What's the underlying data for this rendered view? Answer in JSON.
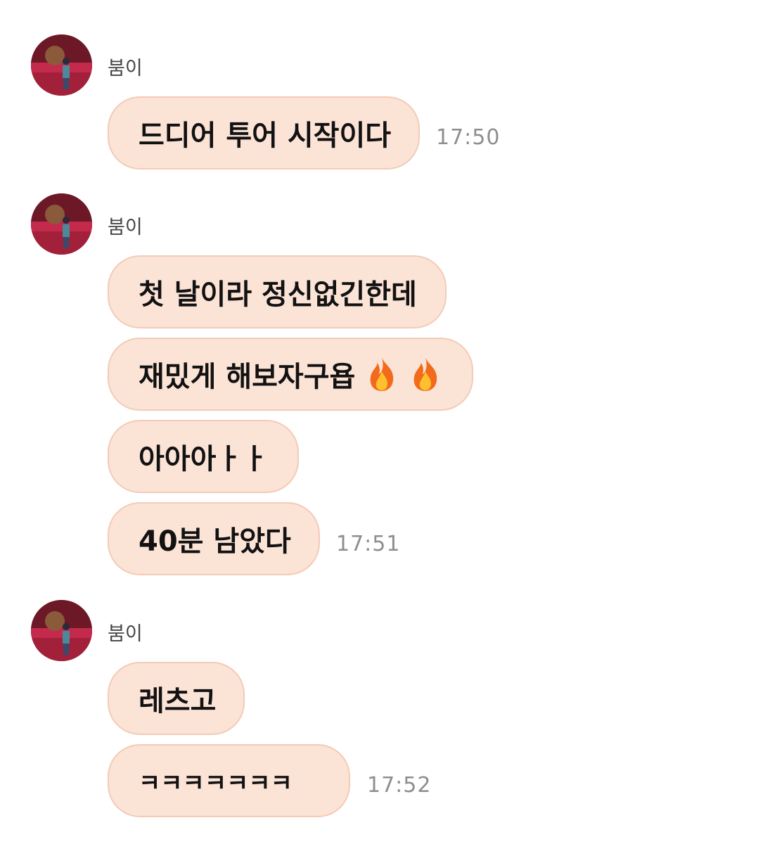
{
  "groups": [
    {
      "sender": "붐이",
      "messages": [
        {
          "text": "드디어 투어 시작이다"
        }
      ],
      "time": "17:50"
    },
    {
      "sender": "붐이",
      "messages": [
        {
          "text": "첫 날이라 정신없긴한데"
        },
        {
          "text": "재밌게 해보자구욥"
        },
        {
          "text": "아아아ㅏㅏ"
        },
        {
          "text": "40분 남았다"
        }
      ],
      "time": "17:51"
    },
    {
      "sender": "붐이",
      "messages": [
        {
          "text": "레츠고"
        },
        {
          "text": "ㅋㅋㅋㅋㅋㅋㅋ"
        }
      ],
      "time": "17:52"
    }
  ],
  "icons": {
    "avatar": "profile-photo",
    "emoji": "fire-emoji"
  },
  "colors": {
    "bubble_fill": "#fbe3d6",
    "bubble_border": "#f3cbb6",
    "time_text": "#8e8e8e",
    "sender_text": "#444444"
  }
}
